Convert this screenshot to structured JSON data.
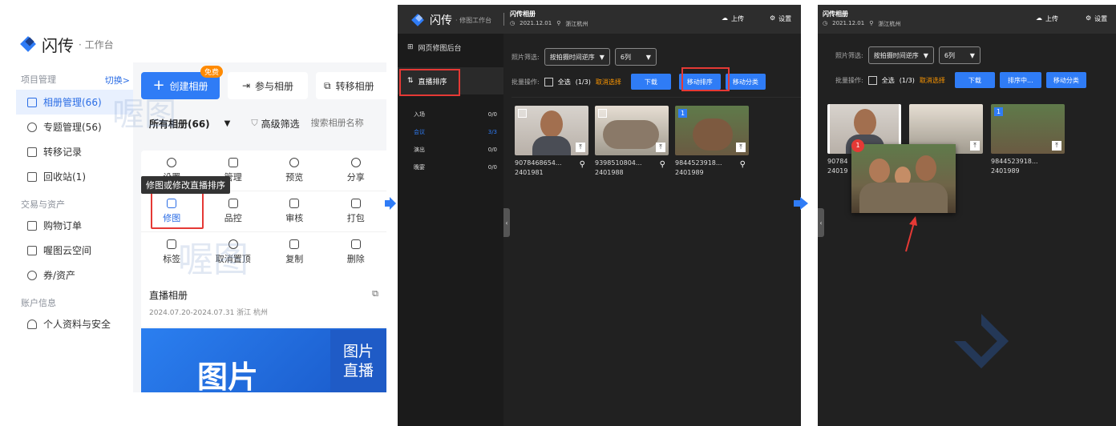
{
  "panel1": {
    "brand": "闪传",
    "brand_sub": "· 工作台",
    "section_project": "项目管理",
    "switch_label": "切换>",
    "nav_project": [
      {
        "label": "相册管理(66)",
        "icon": "album-icon"
      },
      {
        "label": "专题管理(56)",
        "icon": "layers-icon"
      },
      {
        "label": "转移记录",
        "icon": "transfer-icon"
      },
      {
        "label": "回收站(1)",
        "icon": "trash-icon"
      }
    ],
    "section_trade": "交易与资产",
    "nav_trade": [
      {
        "label": "购物订单",
        "icon": "order-icon"
      },
      {
        "label": "喔图云空间",
        "icon": "cloud-space-icon"
      },
      {
        "label": "券/资产",
        "icon": "coupon-icon"
      }
    ],
    "section_account": "账户信息",
    "nav_account": [
      {
        "label": "个人资料与安全",
        "icon": "user-icon"
      }
    ],
    "create_button": "创建相册",
    "free_badge": "免费",
    "join_button": "参与相册",
    "transfer_button": "转移相册",
    "filter_all": "所有相册(66)",
    "advanced_filter": "高级筛选",
    "search_placeholder": "搜索相册名称",
    "actions_row1": [
      "设置",
      "管理",
      "预览",
      "分享"
    ],
    "tooltip": "修图或修改直播排序",
    "actions_row2": [
      "修图",
      "品控",
      "审核",
      "打包"
    ],
    "actions_row3": [
      "标签",
      "取消置顶",
      "复制",
      "删除"
    ],
    "album_title": "直播相册",
    "album_meta": "2024.07.20-2024.07.31 浙江 杭州",
    "banner_big": "图片",
    "banner_side_1": "图片",
    "banner_side_2": "直播",
    "watermark": "喔图"
  },
  "panel2": {
    "brand": "闪传",
    "brand_sub": "· 修图工作台",
    "album_name": "闪传相册",
    "album_date": "2021.12.01",
    "album_location": "浙江杭州",
    "upload": "上传",
    "settings": "设置",
    "menu_backend": "网页修图后台",
    "menu_live_sort": "直播排序",
    "categories": [
      {
        "name": "入场",
        "count": "0/0"
      },
      {
        "name": "会议",
        "count": "3/3"
      },
      {
        "name": "演出",
        "count": "0/0"
      },
      {
        "name": "晚宴",
        "count": "0/0"
      }
    ],
    "filter_label": "照片筛选:",
    "sort_select": "按拍摄时间逆序",
    "cols_select": "6列",
    "batch_label": "批量操作:",
    "select_all": "全选",
    "selected_count": "(1/3)",
    "cancel_select": "取消选择",
    "download": "下载",
    "move_sort": "移动排序",
    "move_category": "移动分类",
    "photos": [
      {
        "name": "9078468654...",
        "code": "2401981"
      },
      {
        "name": "9398510804...",
        "code": "2401988"
      },
      {
        "name": "9844523918...",
        "code": "2401989",
        "badge": "1"
      }
    ]
  },
  "panel3": {
    "album_name": "闪传相册",
    "album_date": "2021.12.01",
    "album_location": "浙江杭州",
    "upload": "上传",
    "settings": "设置",
    "filter_label": "照片筛选:",
    "sort_select": "按拍摄时间逆序",
    "cols_select": "6列",
    "batch_label": "批量操作:",
    "select_all": "全选",
    "selected_count": "(1/3)",
    "cancel_select": "取消选择",
    "download": "下载",
    "sorting": "排序中...",
    "move_category": "移动分类",
    "photos": [
      {
        "name": "90784",
        "code": "24019"
      },
      {
        "name": "9844523918...",
        "code": "2401989",
        "badge": "1"
      }
    ],
    "drag_badge": "1"
  },
  "colors": {
    "accent": "#2f7cf6",
    "highlight": "#e53935",
    "badge_orange": "#ff8a00"
  }
}
